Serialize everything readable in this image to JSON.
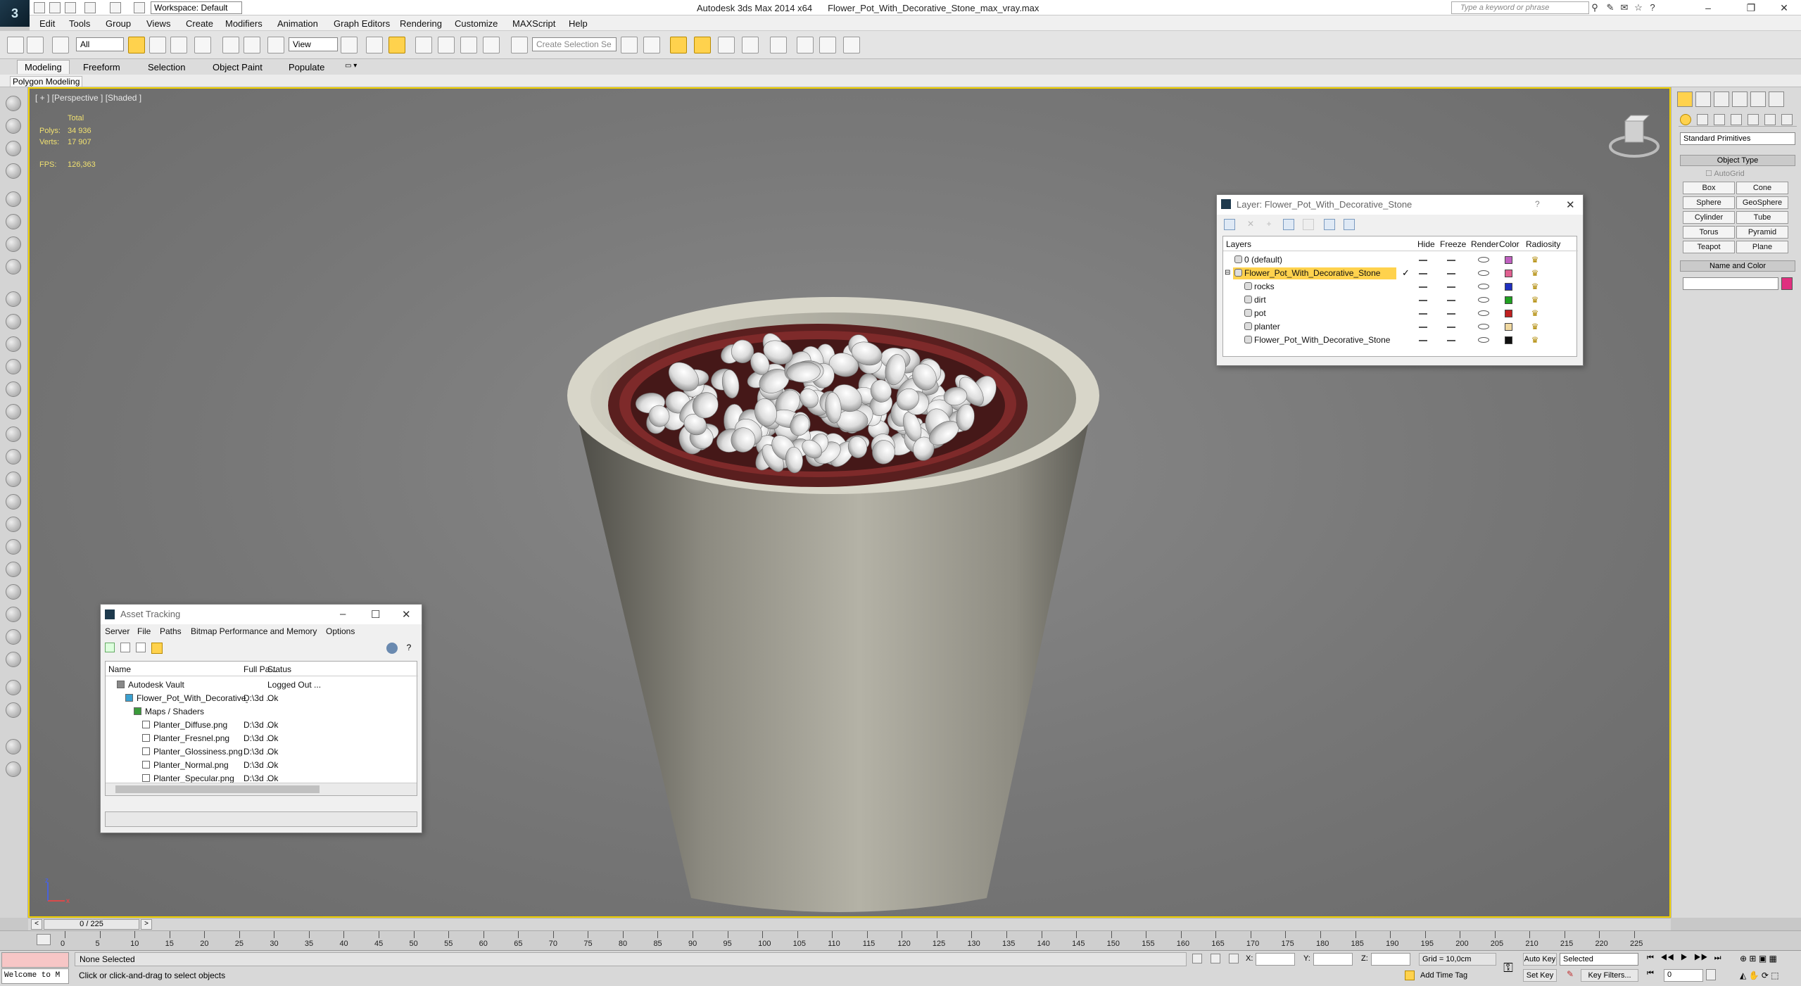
{
  "app": {
    "title": "Autodesk 3ds Max  2014 x64",
    "file": "Flower_Pot_With_Decorative_Stone_max_vray.max",
    "workspace": "Workspace: Default",
    "search_placeholder": "Type a keyword or phrase"
  },
  "menu": [
    "Edit",
    "Tools",
    "Group",
    "Views",
    "Create",
    "Modifiers",
    "Animation",
    "Graph Editors",
    "Rendering",
    "Customize",
    "MAXScript",
    "Help"
  ],
  "toolbar": {
    "filter_value": "All",
    "refcoord_value": "View",
    "named_selection_placeholder": "Create Selection Se"
  },
  "ribbon": {
    "tabs": [
      "Modeling",
      "Freeform",
      "Selection",
      "Object Paint",
      "Populate"
    ],
    "sub": "Polygon Modeling"
  },
  "viewport": {
    "label": "[ + ] [Perspective ] [Shaded ]",
    "stats_header": "Total",
    "polys_label": "Polys:",
    "polys_value": "34 936",
    "verts_label": "Verts:",
    "verts_value": "17 907",
    "fps_label": "FPS:",
    "fps_value": "126,363"
  },
  "layer_dialog": {
    "title": "Layer: Flower_Pot_With_Decorative_Stone",
    "help": "?",
    "columns": [
      "Layers",
      "Hide",
      "Freeze",
      "Render",
      "Color",
      "Radiosity"
    ],
    "rows": [
      {
        "name": "0 (default)",
        "color": "#c060c0",
        "indent": 0,
        "selected": false
      },
      {
        "name": "Flower_Pot_With_Decorative_Stone",
        "color": "#e06090",
        "indent": 0,
        "selected": true
      },
      {
        "name": "rocks",
        "color": "#2030c0",
        "indent": 1,
        "selected": false
      },
      {
        "name": "dirt",
        "color": "#20a020",
        "indent": 1,
        "selected": false
      },
      {
        "name": "pot",
        "color": "#c02020",
        "indent": 1,
        "selected": false
      },
      {
        "name": "planter",
        "color": "#f0d8a0",
        "indent": 1,
        "selected": false
      },
      {
        "name": "Flower_Pot_With_Decorative_Stone",
        "color": "#101010",
        "indent": 1,
        "selected": false
      }
    ]
  },
  "asset_dialog": {
    "title": "Asset Tracking",
    "menu": [
      "Server",
      "File",
      "Paths",
      "Bitmap Performance and Memory",
      "Options"
    ],
    "columns": [
      "Name",
      "Full Pa...",
      "Status"
    ],
    "rows": [
      {
        "name": "Autodesk Vault",
        "path": "",
        "status": "Logged Out ...",
        "indent": 1
      },
      {
        "name": "Flower_Pot_With_Decorative_Stone_max_vra...",
        "path": "D:\\3d ...",
        "status": "Ok",
        "indent": 2
      },
      {
        "name": "Maps / Shaders",
        "path": "",
        "status": "",
        "indent": 3
      },
      {
        "name": "Planter_Diffuse.png",
        "path": "D:\\3d ...",
        "status": "Ok",
        "indent": 4
      },
      {
        "name": "Planter_Fresnel.png",
        "path": "D:\\3d ...",
        "status": "Ok",
        "indent": 4
      },
      {
        "name": "Planter_Glossiness.png",
        "path": "D:\\3d ...",
        "status": "Ok",
        "indent": 4
      },
      {
        "name": "Planter_Normal.png",
        "path": "D:\\3d ...",
        "status": "Ok",
        "indent": 4
      },
      {
        "name": "Planter_Specular.png",
        "path": "D:\\3d ...",
        "status": "Ok",
        "indent": 4
      }
    ]
  },
  "command_panel": {
    "dropdown": "Standard Primitives",
    "object_type": "Object Type",
    "autogrid": "AutoGrid",
    "buttons": [
      "Box",
      "Cone",
      "Sphere",
      "GeoSphere",
      "Cylinder",
      "Tube",
      "Torus",
      "Pyramid",
      "Teapot",
      "Plane"
    ],
    "name_color": "Name and Color",
    "swatch": "#e0307f"
  },
  "timeline": {
    "frame": "0 / 225",
    "ticks": [
      "0",
      "5",
      "10",
      "15",
      "20",
      "25",
      "30",
      "35",
      "40",
      "45",
      "50",
      "55",
      "60",
      "65",
      "70",
      "75",
      "80",
      "85",
      "90",
      "95",
      "100",
      "105",
      "110",
      "115",
      "120",
      "125",
      "130",
      "135",
      "140",
      "145",
      "150",
      "155",
      "160",
      "165",
      "170",
      "175",
      "180",
      "185",
      "190",
      "195",
      "200",
      "205",
      "210",
      "215",
      "220",
      "225"
    ]
  },
  "status": {
    "maxscript": "Welcome to M",
    "selection": "None Selected",
    "prompt": "Click or click-and-drag to select objects",
    "x_label": "X:",
    "y_label": "Y:",
    "z_label": "Z:",
    "grid": "Grid = 10,0cm",
    "add_time_tag": "Add Time Tag",
    "auto_key": "Auto Key",
    "set_key": "Set Key",
    "selected": "Selected",
    "key_filters": "Key Filters...",
    "frame_value": "0"
  }
}
